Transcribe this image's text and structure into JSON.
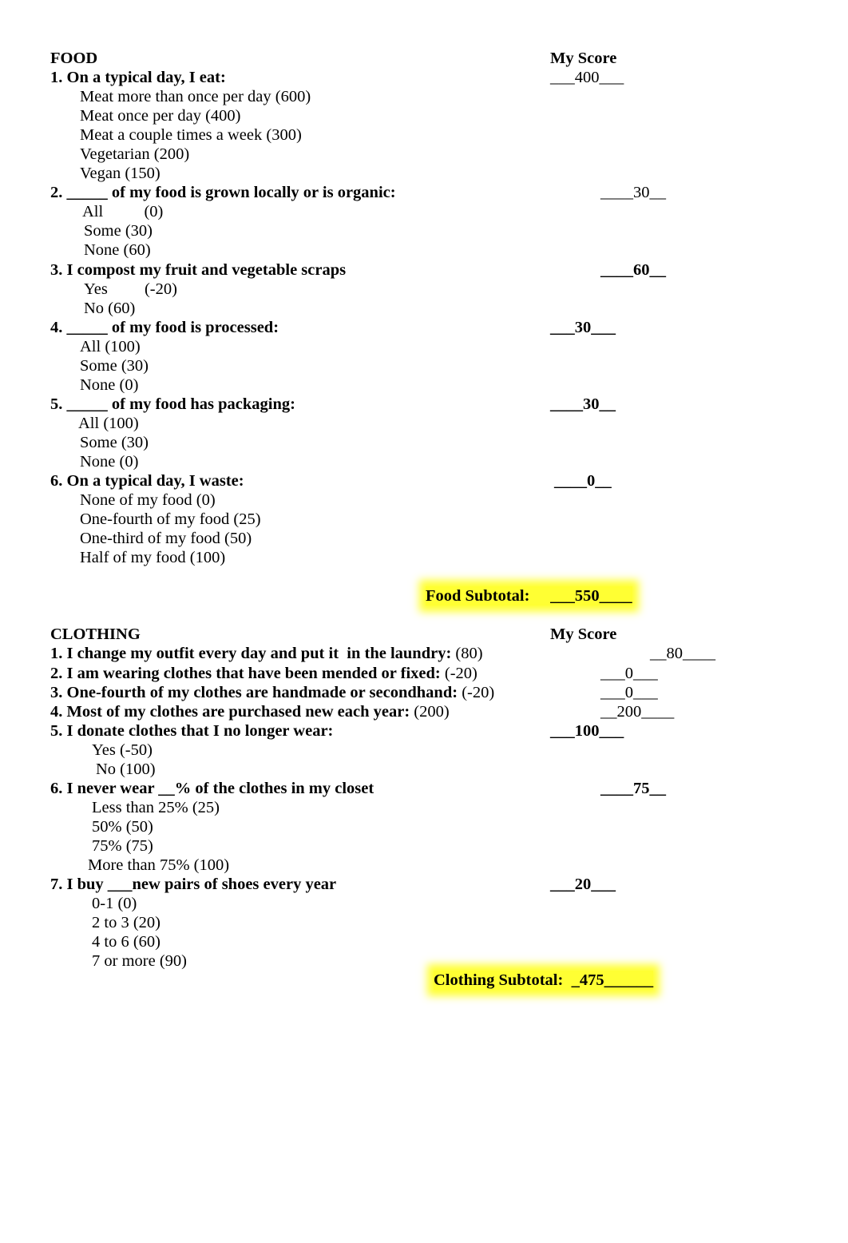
{
  "food": {
    "heading": "FOOD",
    "score_heading": "My Score",
    "questions": [
      {
        "text": "1. On a typical day, I eat:",
        "score": "___400___",
        "options": [
          "Meat more than once per day (600)",
          "Meat once per day (400)",
          "Meat a couple times a week (300)",
          "Vegetarian (200)",
          "Vegan (150)"
        ]
      },
      {
        "text": "2. _____ of my food is grown locally or is organic:",
        "score": "____30__",
        "options": [
          "All          (0)",
          "Some (30)",
          "None (60)"
        ]
      },
      {
        "text": "3. I compost my fruit and vegetable scraps",
        "score": "____60__",
        "options": [
          "Yes         (-20)",
          "No (60)"
        ]
      },
      {
        "text": "4. _____ of my food is processed:",
        "score": "___30___",
        "options": [
          "All (100)",
          "Some (30)",
          "None (0)"
        ]
      },
      {
        "text": "5. _____ of my food has packaging:",
        "score": "____30__",
        "options": [
          "All (100)",
          "Some (30)",
          "None (0)"
        ]
      },
      {
        "text": "6. On a typical day, I waste:",
        "score": "____0__",
        "options": [
          "None of my food (0)",
          "One-fourth of my food (25)",
          "One-third of my food (50)",
          "Half of my food (100)"
        ]
      }
    ],
    "subtotal_label": "Food Subtotal:",
    "subtotal_value": "___550____"
  },
  "clothing": {
    "heading": "CLOTHING",
    "score_heading": "My Score",
    "questions": [
      {
        "text": "1. I change my outfit every day and put it  in the laundry:",
        "points": " (80)",
        "score": "__80____"
      },
      {
        "text": "2. I am wearing clothes that have been mended or fixed:",
        "points": " (-20)",
        "score": "___0___"
      },
      {
        "text": "3. One-fourth of my clothes are handmade or secondhand:",
        "points": " (-20)",
        "score": "___0___"
      },
      {
        "text": "4. Most of my clothes are purchased new each year:",
        "points": " (200)",
        "score": "__200____"
      },
      {
        "text": "5. I donate clothes that I no longer wear:",
        "score": "___100___",
        "options": [
          "Yes (-50)",
          "No (100)"
        ]
      },
      {
        "text": "6. I never wear __% of the clothes in my closet",
        "score": "____75__",
        "options": [
          "Less than 25% (25)",
          "50% (50)",
          "75% (75)",
          "More than 75% (100)"
        ]
      },
      {
        "text": "7. I buy ___new pairs of shoes every year",
        "score": "___20___",
        "options": [
          "0-1 (0)",
          "2 to 3 (20)",
          "4 to 6 (60)",
          "7 or more (90)"
        ]
      }
    ],
    "subtotal_label": "Clothing Subtotal:",
    "subtotal_value": "_475______"
  }
}
